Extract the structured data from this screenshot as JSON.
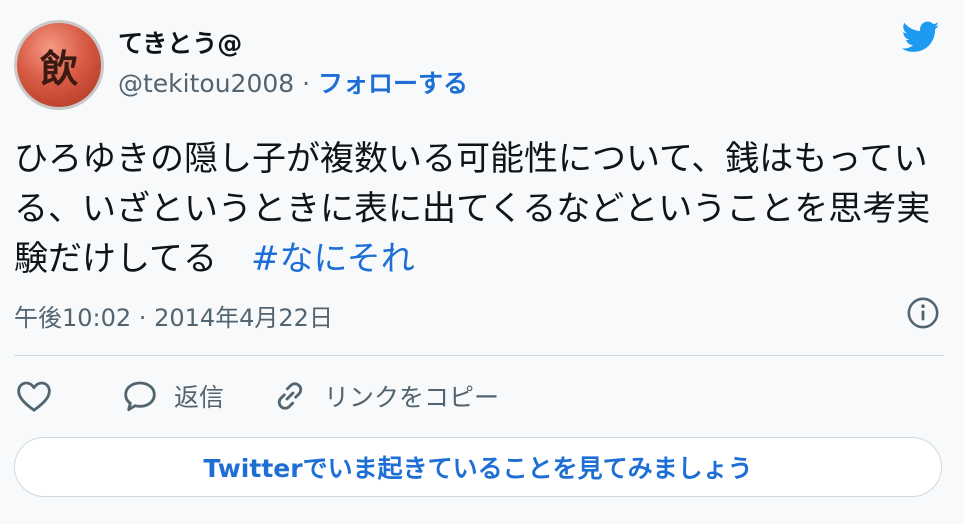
{
  "author": {
    "avatar_glyph": "飲",
    "display_name": "てきとう@",
    "handle": "@tekitou2008",
    "separator": " · ",
    "follow_label": "フォローする"
  },
  "tweet": {
    "text": "ひろゆきの隠し子が複数いる可能性について、銭はもっている、いざというときに表に出てくるなどということを思考実験だけしてる　",
    "hashtag": "#なにそれ"
  },
  "meta": {
    "time": "午後10:02",
    "separator": " · ",
    "date": "2014年4月22日"
  },
  "actions": {
    "reply_label": "返信",
    "copy_link_label": "リンクをコピー"
  },
  "cta": {
    "label": "Twitterでいま起きていることを見てみましょう"
  },
  "colors": {
    "accent": "#1d6fd6",
    "twitter_blue": "#1d9bf0",
    "secondary_text": "#536471",
    "background": "#f7f9fa"
  },
  "icons": [
    "twitter-bird-icon",
    "info-icon",
    "heart-icon",
    "reply-icon",
    "link-icon"
  ]
}
